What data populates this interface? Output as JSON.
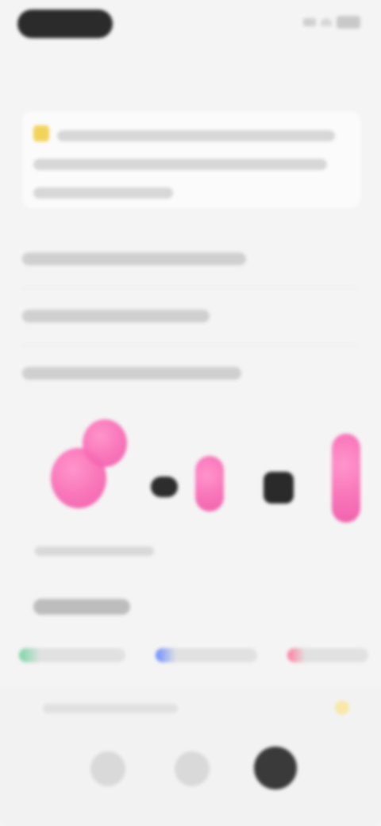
{
  "status_bar": {
    "time": "",
    "icons": [
      "signal-icon",
      "wifi-icon",
      "battery-icon"
    ]
  },
  "header": {
    "title": ""
  },
  "note": {
    "icon": "warning-icon",
    "text": ""
  },
  "sections": [
    {
      "title": ""
    },
    {
      "title": ""
    },
    {
      "title": ""
    }
  ],
  "exercise": {
    "items": [
      "pink-bow-cluster",
      "times-sign",
      "pink-bow",
      "equals-sign",
      "pink-bow-tall"
    ]
  },
  "answer_hint": {
    "text": ""
  },
  "solution": {
    "title": ""
  },
  "chips": [
    {
      "label": "",
      "color": "#7cd6a7"
    },
    {
      "label": "",
      "color": "#6c8cff"
    },
    {
      "label": "",
      "color": "#ff7b9a"
    }
  ],
  "bottom": {
    "hint": "",
    "nav": [
      "back-icon",
      "options-icon",
      "camera-icon"
    ]
  },
  "colors": {
    "accent_pink": "#f86fb6",
    "warning": "#f2d35a"
  }
}
